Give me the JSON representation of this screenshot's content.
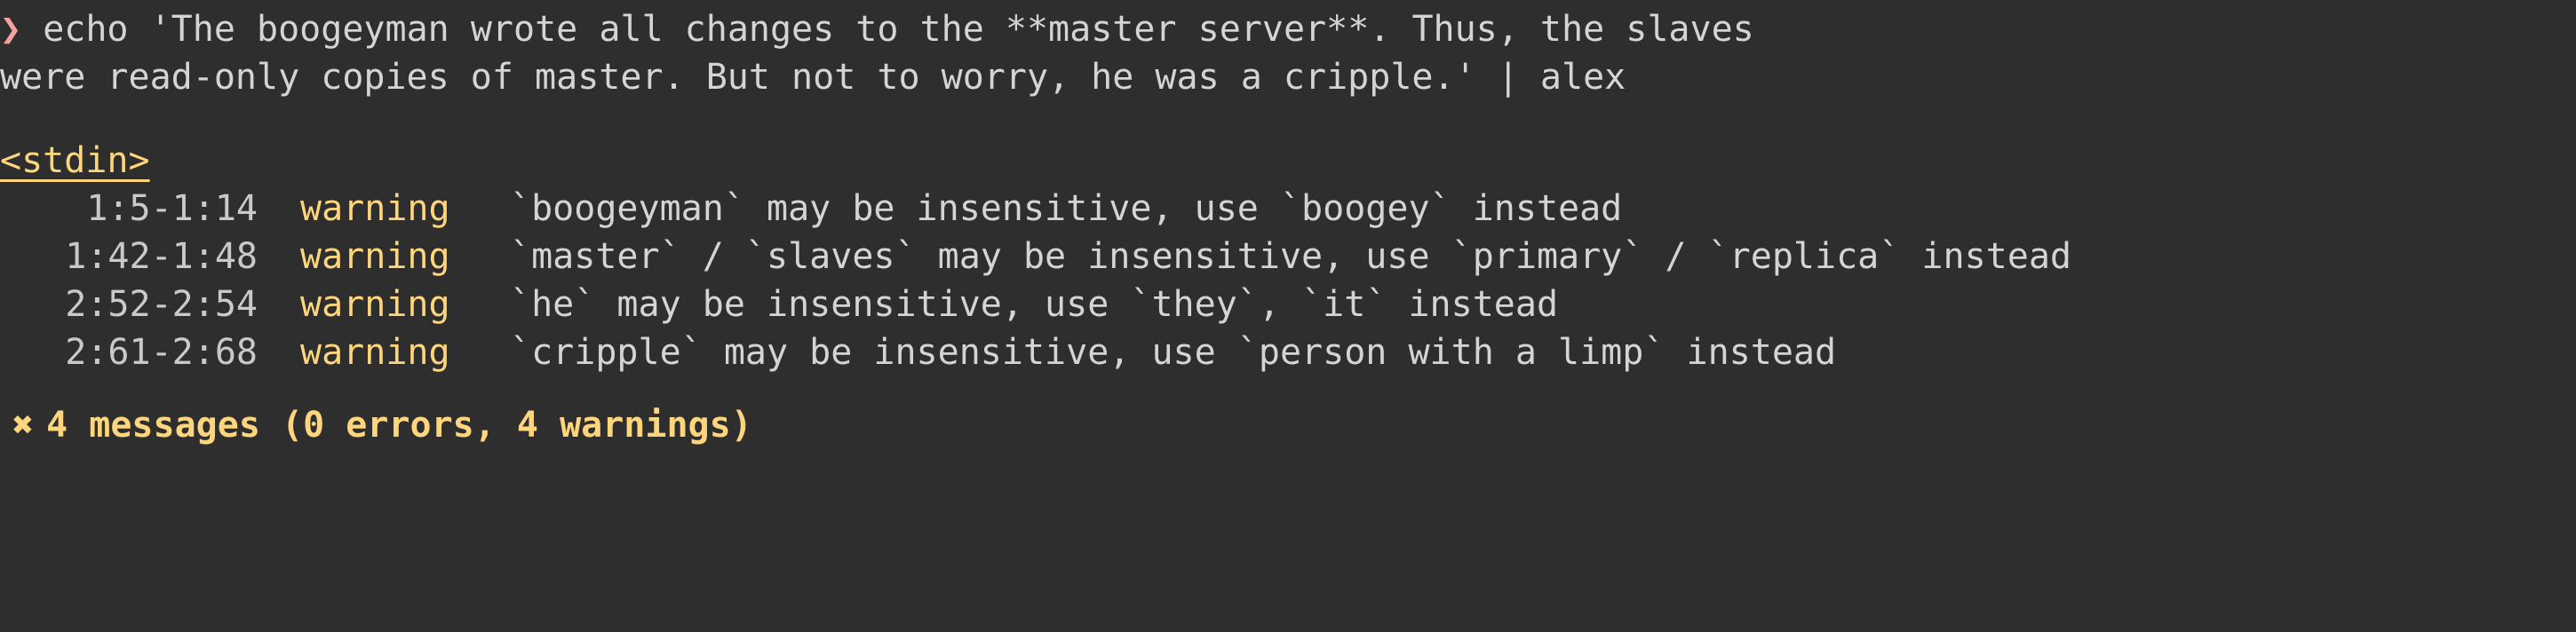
{
  "terminal": {
    "prompt_symbol": "❯",
    "command_lines": [
      "echo 'The boogeyman wrote all changes to the **master server**. Thus, the slaves",
      "were read-only copies of master. But not to worry, he was a cripple.' | alex"
    ],
    "file_header": "<stdin>",
    "messages": [
      {
        "position": "1:5-1:14",
        "severity": "warning",
        "reason": "`boogeyman` may be insensitive, use `boogey` instead"
      },
      {
        "position": "1:42-1:48",
        "severity": "warning",
        "reason": "`master` / `slaves` may be insensitive, use `primary` / `replica` instead"
      },
      {
        "position": "2:52-2:54",
        "severity": "warning",
        "reason": "`he` may be insensitive, use `they`, `it` instead"
      },
      {
        "position": "2:61-2:68",
        "severity": "warning",
        "reason": "`cripple` may be insensitive, use `person with a limp` instead"
      }
    ],
    "summary": {
      "icon": "heavy-multiplication-x",
      "icon_glyph": "✖",
      "text": "4 messages (0 errors, 4 warnings)"
    },
    "colors": {
      "background": "#2e2e2e",
      "foreground": "#d4d4d4",
      "prompt": "#f4a29b",
      "warning": "#fcd57c",
      "file_header": "#fcd57c"
    }
  }
}
